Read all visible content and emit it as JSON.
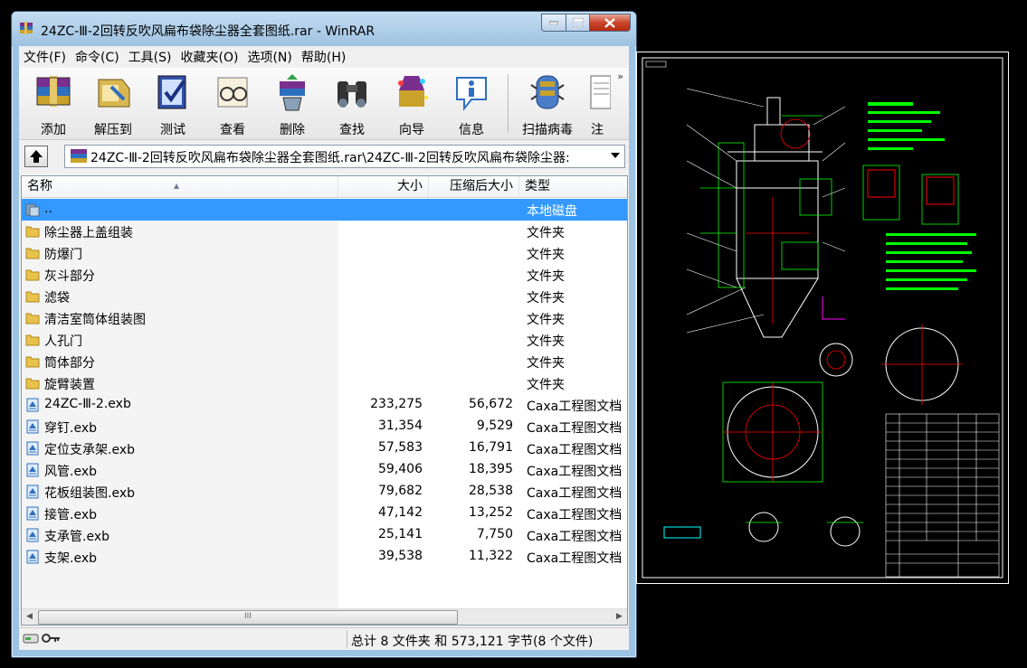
{
  "window": {
    "title": "24ZC-Ⅲ-2回转反吹风扁布袋除尘器全套图纸.rar - WinRAR",
    "controls": {
      "minimize": "minimize-icon",
      "maximize": "maximize-icon",
      "close": "close-icon"
    }
  },
  "menu": [
    "文件(F)",
    "命令(C)",
    "工具(S)",
    "收藏夹(O)",
    "选项(N)",
    "帮助(H)"
  ],
  "toolbar": {
    "add": "添加",
    "extract": "解压到",
    "test": "测试",
    "view": "查看",
    "delete": "删除",
    "find": "查找",
    "wizard": "向导",
    "info": "信息",
    "virus_scan": "扫描病毒",
    "comment": "注",
    "more": "»"
  },
  "address": {
    "path": "24ZC-Ⅲ-2回转反吹风扁布袋除尘器全套图纸.rar\\24ZC-Ⅲ-2回转反吹风扁布袋除尘器:"
  },
  "columns": {
    "name": "名称",
    "size": "大小",
    "packed": "压缩后大小",
    "type": "类型"
  },
  "files": [
    {
      "name": "..",
      "size": "",
      "packed": "",
      "type": "本地磁盘",
      "kind": "up",
      "selected": true
    },
    {
      "name": "除尘器上盖组装",
      "size": "",
      "packed": "",
      "type": "文件夹",
      "kind": "folder"
    },
    {
      "name": "防爆门",
      "size": "",
      "packed": "",
      "type": "文件夹",
      "kind": "folder"
    },
    {
      "name": "灰斗部分",
      "size": "",
      "packed": "",
      "type": "文件夹",
      "kind": "folder"
    },
    {
      "name": "滤袋",
      "size": "",
      "packed": "",
      "type": "文件夹",
      "kind": "folder"
    },
    {
      "name": "清洁室筒体组装图",
      "size": "",
      "packed": "",
      "type": "文件夹",
      "kind": "folder"
    },
    {
      "name": "人孔门",
      "size": "",
      "packed": "",
      "type": "文件夹",
      "kind": "folder"
    },
    {
      "name": "筒体部分",
      "size": "",
      "packed": "",
      "type": "文件夹",
      "kind": "folder"
    },
    {
      "name": "旋臂装置",
      "size": "",
      "packed": "",
      "type": "文件夹",
      "kind": "folder"
    },
    {
      "name": "24ZC-Ⅲ-2.exb",
      "size": "233,275",
      "packed": "56,672",
      "type": "Caxa工程图文档",
      "kind": "file"
    },
    {
      "name": "穿钉.exb",
      "size": "31,354",
      "packed": "9,529",
      "type": "Caxa工程图文档",
      "kind": "file"
    },
    {
      "name": "定位支承架.exb",
      "size": "57,583",
      "packed": "16,791",
      "type": "Caxa工程图文档",
      "kind": "file"
    },
    {
      "name": "风管.exb",
      "size": "59,406",
      "packed": "18,395",
      "type": "Caxa工程图文档",
      "kind": "file"
    },
    {
      "name": "花板组装图.exb",
      "size": "79,682",
      "packed": "28,538",
      "type": "Caxa工程图文档",
      "kind": "file"
    },
    {
      "name": "接管.exb",
      "size": "47,142",
      "packed": "13,252",
      "type": "Caxa工程图文档",
      "kind": "file"
    },
    {
      "name": "支承管.exb",
      "size": "25,141",
      "packed": "7,750",
      "type": "Caxa工程图文档",
      "kind": "file"
    },
    {
      "name": "支架.exb",
      "size": "39,538",
      "packed": "11,322",
      "type": "Caxa工程图文档",
      "kind": "file"
    }
  ],
  "status": {
    "summary": "总计 8 文件夹 和 573,121 字节(8 个文件)"
  },
  "scrollbar": {
    "thumb_grip": "III"
  },
  "colors": {
    "selection": "#3399ff",
    "cad_green": "#00ff00",
    "cad_white": "#ffffff",
    "cad_red": "#ff0000",
    "cad_magenta": "#ff00ff"
  }
}
